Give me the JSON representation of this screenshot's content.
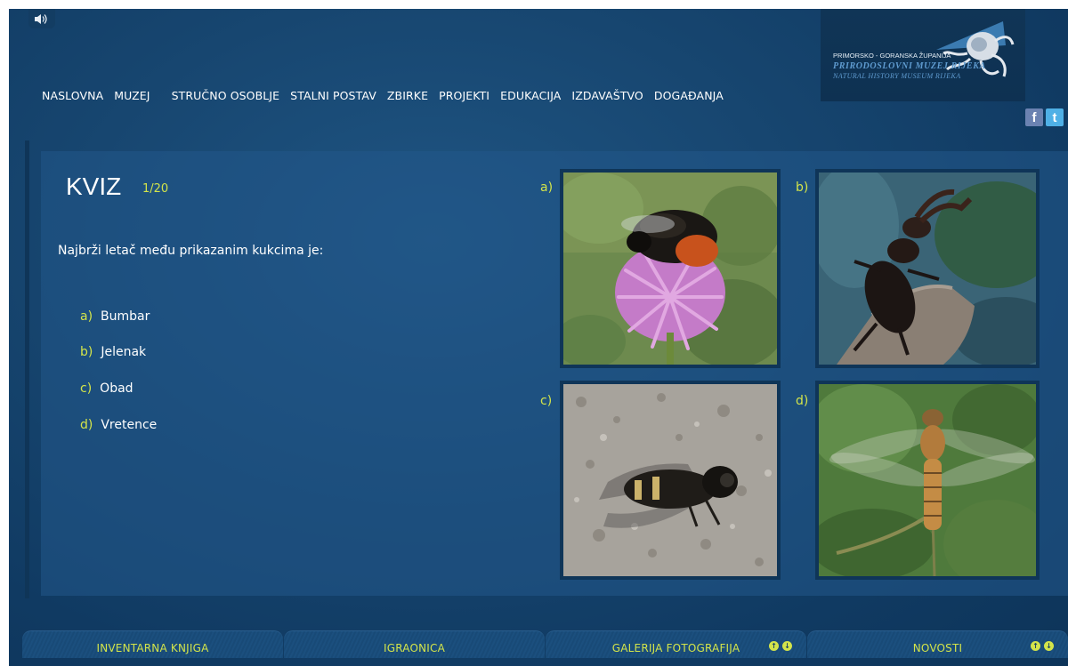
{
  "header": {
    "sound_icon": "speaker-icon",
    "nav": [
      "NASLOVNA",
      "MUZEJ",
      "STRUČNO OSOBLJE",
      "STALNI POSTAV",
      "ZBIRKE",
      "PROJEKTI",
      "EDUKACIJA",
      "IZDAVAŠTVO",
      "DOGAĐANJA"
    ],
    "logo": {
      "line1": "PRIMORSKO - GORANSKA ŽUPANIJA",
      "line2": "PRIRODOSLOVNI MUZEJ RIJEKA",
      "line3": "NATURAL HISTORY MUSEUM RIJEKA"
    },
    "social": {
      "facebook": "f",
      "twitter": "t"
    }
  },
  "quiz": {
    "title": "KVIZ",
    "counter": "1/20",
    "question": "Najbrži letač među prikazanim kukcima je:",
    "answers": [
      {
        "letter": "a)",
        "text": "Bumbar"
      },
      {
        "letter": "b)",
        "text": "Jelenak"
      },
      {
        "letter": "c)",
        "text": "Obad"
      },
      {
        "letter": "d)",
        "text": "Vretence"
      }
    ],
    "images": [
      {
        "label": "a)",
        "subject": "bumblebee-photo"
      },
      {
        "label": "b)",
        "subject": "stag-beetle-photo"
      },
      {
        "label": "c)",
        "subject": "horsefly-photo"
      },
      {
        "label": "d)",
        "subject": "dragonfly-photo"
      }
    ]
  },
  "footer": {
    "tabs": [
      {
        "label": "INVENTARNA KNJIGA"
      },
      {
        "label": "IGRAONICA"
      },
      {
        "label": "GALERIJA FOTOGRAFIJA"
      },
      {
        "label": "NOVOSTI"
      }
    ],
    "arrow_up": "↑",
    "arrow_down": "↓"
  },
  "colors": {
    "accent": "#d3e44a",
    "background": "#174670",
    "panel": "#22588a",
    "frame": "#0f3558"
  }
}
